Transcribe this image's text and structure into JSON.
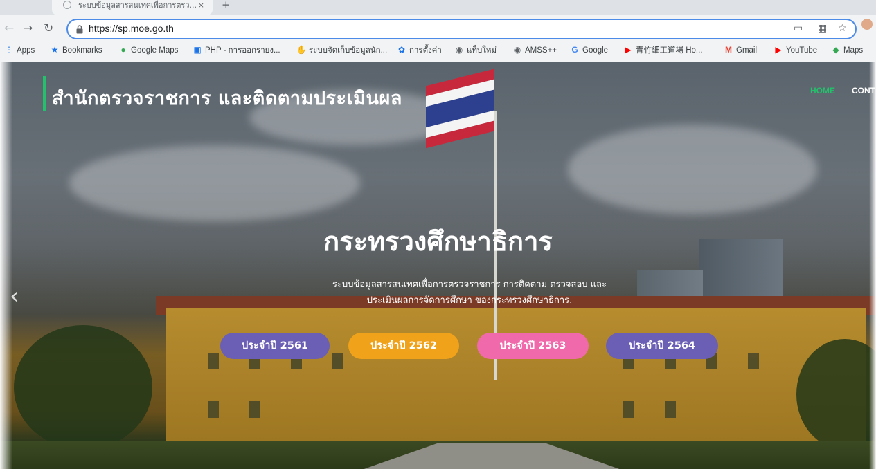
{
  "browser": {
    "tab_title": "ระบบข้อมูลสารสนเทศเพื่อการตรว...",
    "tab_close": "×",
    "new_tab": "+",
    "url": "https://sp.moe.go.th",
    "bookmarks": [
      {
        "label": "Apps",
        "icon": "apps-grid-icon"
      },
      {
        "label": "Bookmarks",
        "icon": "star-icon"
      },
      {
        "label": "Google Maps",
        "icon": "maps-pin-icon"
      },
      {
        "label": "PHP - การออกรายง...",
        "icon": "php-icon"
      },
      {
        "label": "ระบบจัดเก็บข้อมูลนัก...",
        "icon": "hand-icon"
      },
      {
        "label": "การตั้งค่า",
        "icon": "gear-icon"
      },
      {
        "label": "แท็บใหม่",
        "icon": "globe-icon"
      },
      {
        "label": "AMSS++",
        "icon": "globe-icon"
      },
      {
        "label": "Google",
        "icon": "google-icon"
      },
      {
        "label": "青竹細工道場 Ho...",
        "icon": "youtube-icon"
      },
      {
        "label": "Gmail",
        "icon": "gmail-icon"
      },
      {
        "label": "YouTube",
        "icon": "youtube-icon"
      },
      {
        "label": "Maps",
        "icon": "maps-icon"
      }
    ]
  },
  "site": {
    "title": "สำนักตรวจราชการ และติดตามประเมินผล",
    "nav": {
      "home": "HOME",
      "contact": "CONT"
    },
    "hero": {
      "title": "กระทรวงศึกษาธิการ",
      "subtitle_line1": "ระบบข้อมูลสารสนเทศเพื่อการตรวจราชการ การติดตาม ตรวจสอบ และ",
      "subtitle_line2": "ประเมินผลการจัดการศึกษา ของกระทรวงศึกษาธิการ."
    },
    "slider_prev": "‹",
    "year_buttons": [
      {
        "label": "ประจำปี 2561",
        "color": "#6b5fb5"
      },
      {
        "label": "ประจำปี 2562",
        "color": "#f0a21a"
      },
      {
        "label": "ประจำปี 2563",
        "color": "#f06aab"
      },
      {
        "label": "ประจำปี 2564",
        "color": "#6b5fb5"
      }
    ],
    "accent_color": "#23c16b"
  }
}
